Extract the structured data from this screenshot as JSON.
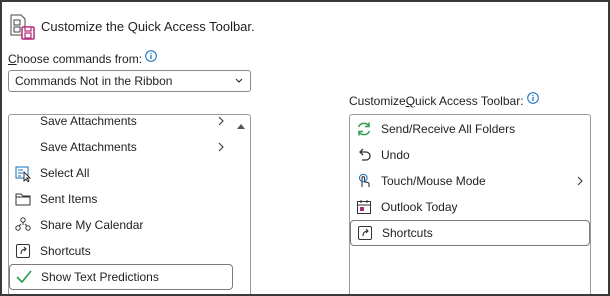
{
  "header": {
    "title": "Customize the Quick Access Toolbar."
  },
  "choose": {
    "label_prefix": "C",
    "label_rest": "hoose commands from:",
    "selected": "Commands Not in the Ribbon"
  },
  "customize": {
    "label_before": "Customize ",
    "label_ul": "Q",
    "label_after": "uick Access Toolbar:"
  },
  "left_items": [
    {
      "label": "Save Attachments",
      "icon": "none",
      "submenu": true
    },
    {
      "label": "Save Attachments",
      "icon": "none",
      "submenu": true
    },
    {
      "label": "Select All",
      "icon": "select-all-icon",
      "submenu": false
    },
    {
      "label": "Sent Items",
      "icon": "folder-icon",
      "submenu": false
    },
    {
      "label": "Share My Calendar",
      "icon": "share-calendar-icon",
      "submenu": false
    },
    {
      "label": "Shortcuts",
      "icon": "shortcut-icon",
      "submenu": false
    },
    {
      "label": "Show Text Predictions",
      "icon": "checkmark-icon",
      "submenu": false,
      "selected": true
    }
  ],
  "right_items": [
    {
      "label": "Send/Receive All Folders",
      "icon": "sync-icon",
      "submenu": false
    },
    {
      "label": "Undo",
      "icon": "undo-icon",
      "submenu": false
    },
    {
      "label": "Touch/Mouse Mode",
      "icon": "touch-icon",
      "submenu": true
    },
    {
      "label": "Outlook Today",
      "icon": "outlook-today-icon",
      "submenu": false
    },
    {
      "label": "Shortcuts",
      "icon": "shortcut-icon",
      "submenu": false,
      "selected": true
    }
  ],
  "colors": {
    "accent": "#0f6cbd",
    "green": "#2e9d4a",
    "border": "#8a8a8a"
  }
}
